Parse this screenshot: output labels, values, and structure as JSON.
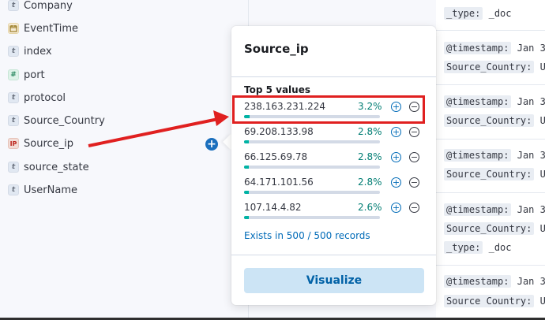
{
  "sidebar": {
    "fields": [
      {
        "name": "Company",
        "type": "t",
        "icon": "string-type-icon"
      },
      {
        "name": "EventTime",
        "type": "d",
        "icon": "date-type-icon"
      },
      {
        "name": "index",
        "type": "t",
        "icon": "string-type-icon"
      },
      {
        "name": "port",
        "type": "#",
        "icon": "number-type-icon"
      },
      {
        "name": "protocol",
        "type": "t",
        "icon": "string-type-icon"
      },
      {
        "name": "Source_Country",
        "type": "t",
        "icon": "string-type-icon"
      },
      {
        "name": "Source_ip",
        "type": "IP",
        "icon": "ip-type-icon"
      },
      {
        "name": "source_state",
        "type": "t",
        "icon": "string-type-icon"
      },
      {
        "name": "UserName",
        "type": "t",
        "icon": "string-type-icon"
      }
    ],
    "add_button": "+"
  },
  "popover": {
    "title": "Source_ip",
    "top_values_heading": "Top 5 values",
    "values": [
      {
        "ip": "238.163.231.224",
        "pct": "3.2%",
        "fraction": 0.032
      },
      {
        "ip": "69.208.133.98",
        "pct": "2.8%",
        "fraction": 0.028
      },
      {
        "ip": "66.125.69.78",
        "pct": "2.8%",
        "fraction": 0.028
      },
      {
        "ip": "64.171.101.56",
        "pct": "2.8%",
        "fraction": 0.028
      },
      {
        "ip": "107.14.4.82",
        "pct": "2.6%",
        "fraction": 0.026
      }
    ],
    "filter_in": "+",
    "filter_out": "−",
    "exists_text": "Exists in 500 / 500 records",
    "visualize_label": "Visualize"
  },
  "documents": {
    "type_key": "_type:",
    "type_value": "_doc",
    "timestamp_key": "@timestamp:",
    "timestamp_value": "Jan 3",
    "country_key": "Source_Country:",
    "country_value": "U",
    "country_key_alt": "Source Country:"
  },
  "colors": {
    "accent": "#006bb8",
    "bar_fill": "#00b3a4",
    "highlight": "#e02020",
    "ip_type": "#bd271e"
  }
}
